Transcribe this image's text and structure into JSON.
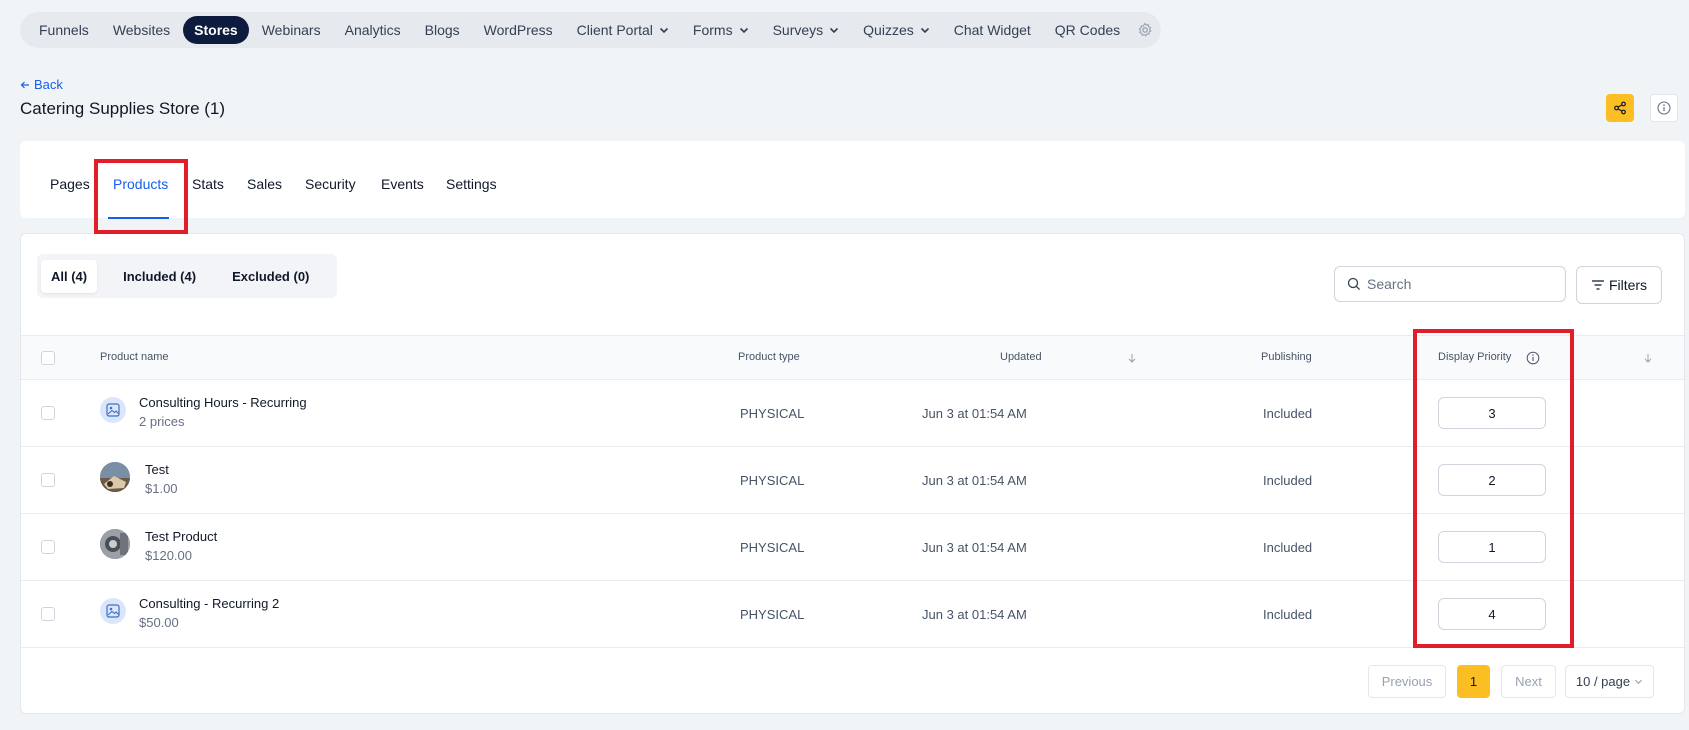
{
  "topnav": {
    "items": [
      {
        "label": "Funnels"
      },
      {
        "label": "Websites"
      },
      {
        "label": "Stores",
        "active": true
      },
      {
        "label": "Webinars"
      },
      {
        "label": "Analytics"
      },
      {
        "label": "Blogs"
      },
      {
        "label": "WordPress"
      },
      {
        "label": "Client Portal",
        "dropdown": true
      },
      {
        "label": "Forms",
        "dropdown": true
      },
      {
        "label": "Surveys",
        "dropdown": true
      },
      {
        "label": "Quizzes",
        "dropdown": true
      },
      {
        "label": "Chat Widget"
      },
      {
        "label": "QR Codes"
      }
    ],
    "settings_icon": "gear-icon"
  },
  "header": {
    "back_label": "Back",
    "title": "Catering Supplies Store (1)",
    "share_icon": "share-icon",
    "info_icon": "info-icon"
  },
  "tabs": [
    {
      "label": "Pages"
    },
    {
      "label": "Products",
      "active": true
    },
    {
      "label": "Stats"
    },
    {
      "label": "Sales"
    },
    {
      "label": "Security"
    },
    {
      "label": "Events"
    },
    {
      "label": "Settings"
    }
  ],
  "segments": [
    {
      "label": "All (4)",
      "active": true
    },
    {
      "label": "Included (4)"
    },
    {
      "label": "Excluded (0)"
    }
  ],
  "search": {
    "placeholder": "Search"
  },
  "filters_label": "Filters",
  "table": {
    "columns": {
      "name": "Product name",
      "type": "Product type",
      "updated": "Updated",
      "publishing": "Publishing",
      "priority": "Display Priority"
    },
    "rows": [
      {
        "name": "Consulting Hours - Recurring",
        "sub": "2 prices",
        "type": "PHYSICAL",
        "updated": "Jun 3 at 01:54 AM",
        "publishing": "Included",
        "priority": "3",
        "thumb": "image-placeholder-icon"
      },
      {
        "name": "Test",
        "sub": "$1.00",
        "type": "PHYSICAL",
        "updated": "Jun 3 at 01:54 AM",
        "publishing": "Included",
        "priority": "2",
        "thumb": "photo"
      },
      {
        "name": "Test Product",
        "sub": "$120.00",
        "type": "PHYSICAL",
        "updated": "Jun 3 at 01:54 AM",
        "publishing": "Included",
        "priority": "1",
        "thumb": "photo"
      },
      {
        "name": "Consulting - Recurring 2",
        "sub": "$50.00",
        "type": "PHYSICAL",
        "updated": "Jun 3 at 01:54 AM",
        "publishing": "Included",
        "priority": "4",
        "thumb": "image-placeholder-icon"
      }
    ]
  },
  "pagination": {
    "previous": "Previous",
    "current": "1",
    "next": "Next",
    "page_size": "10 / page"
  },
  "colors": {
    "accent": "#155eef",
    "brand_yellow": "#fbbf24",
    "highlight_red": "#e11d2a",
    "nav_active": "#0d1b3e"
  }
}
